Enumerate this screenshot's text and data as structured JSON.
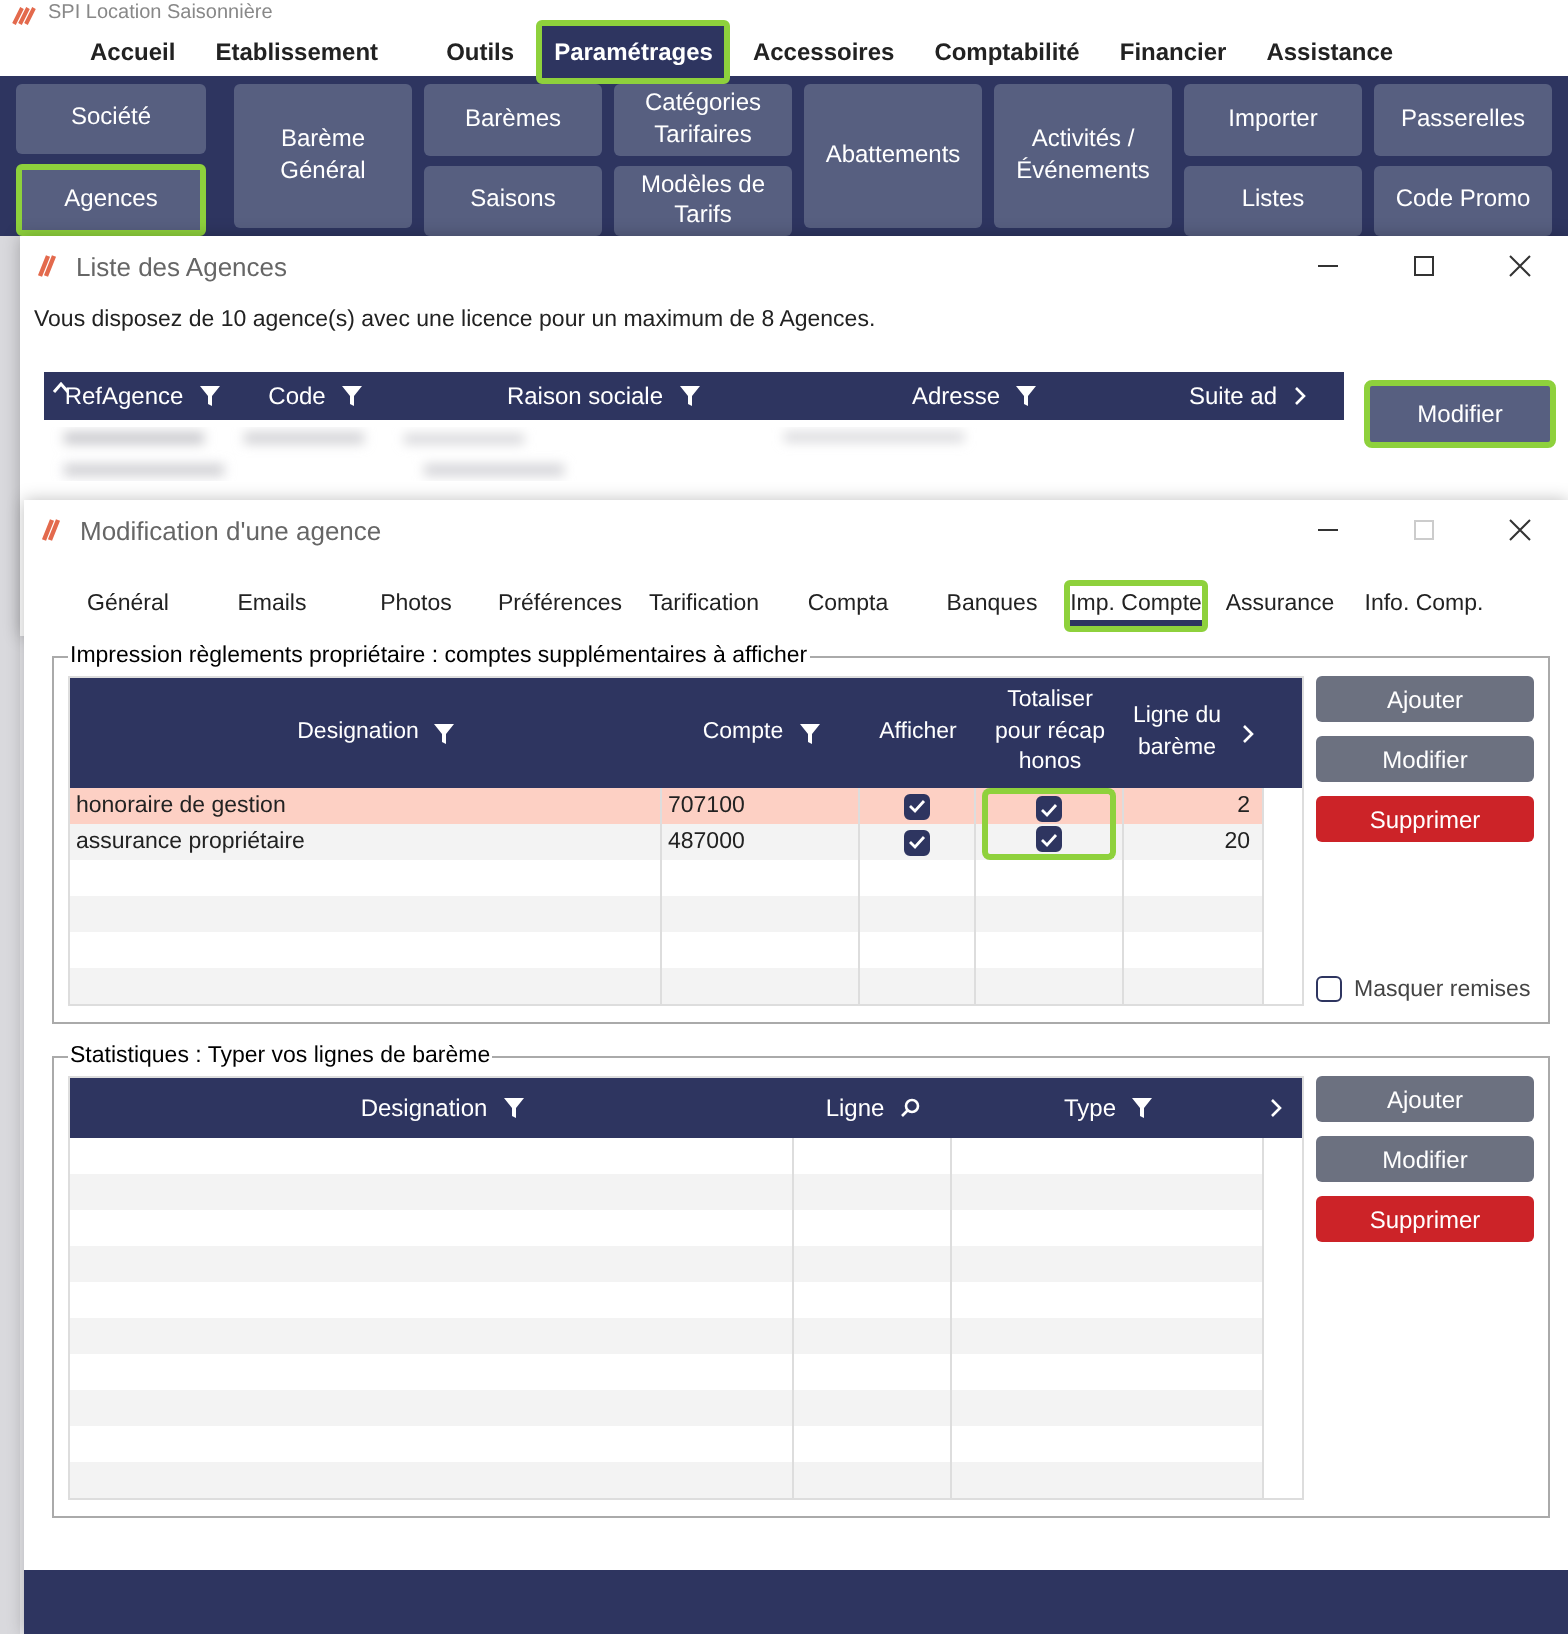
{
  "app": {
    "title": "SPI Location Saisonnière"
  },
  "menu": [
    {
      "label": "Accueil",
      "selected": false,
      "highlighted": false
    },
    {
      "label": "Etablissement",
      "selected": false,
      "highlighted": false
    },
    {
      "label": "Outils",
      "selected": false,
      "highlighted": false
    },
    {
      "label": "Paramétrages",
      "selected": true,
      "highlighted": true
    },
    {
      "label": "Accessoires",
      "selected": false,
      "highlighted": false
    },
    {
      "label": "Comptabilité",
      "selected": false,
      "highlighted": false
    },
    {
      "label": "Financier",
      "selected": false,
      "highlighted": false
    },
    {
      "label": "Assistance",
      "selected": false,
      "highlighted": false
    }
  ],
  "ribbon": [
    {
      "buttons": [
        {
          "label": "Société",
          "highlighted": false
        },
        {
          "label": "Agences",
          "highlighted": true
        }
      ]
    },
    {
      "buttons": [
        {
          "label": "Barème Général",
          "highlighted": false
        }
      ]
    },
    {
      "buttons": [
        {
          "label": "Barèmes",
          "highlighted": false
        },
        {
          "label": "Saisons",
          "highlighted": false
        }
      ]
    },
    {
      "buttons": [
        {
          "label": "Catégories Tarifaires",
          "highlighted": false
        },
        {
          "label": "Modèles de Tarifs",
          "highlighted": false
        }
      ]
    },
    {
      "buttons": [
        {
          "label": "Abattements",
          "highlighted": false
        }
      ]
    },
    {
      "buttons": [
        {
          "label": "Activités / Événements",
          "highlighted": false
        }
      ]
    },
    {
      "buttons": [
        {
          "label": "Importer",
          "highlighted": false
        },
        {
          "label": "Listes",
          "highlighted": false
        }
      ]
    },
    {
      "buttons": [
        {
          "label": "Passerelles",
          "highlighted": false
        },
        {
          "label": "Code Promo",
          "highlighted": false
        }
      ]
    }
  ],
  "agency_list_window": {
    "title": "Liste des Agences",
    "message": "Vous disposez de 10 agence(s) avec une licence pour un maximum de 8 Agences.",
    "columns": [
      {
        "label": "RefAgence"
      },
      {
        "label": "Code"
      },
      {
        "label": "Raison sociale"
      },
      {
        "label": "Adresse"
      },
      {
        "label": "Suite ad"
      }
    ],
    "actions": [
      {
        "label": "Modifier",
        "highlighted": true
      }
    ]
  },
  "edit_window": {
    "title": "Modification d'une agence",
    "tabs": [
      {
        "label": "Général",
        "selected": false,
        "highlighted": false
      },
      {
        "label": "Emails",
        "selected": false,
        "highlighted": false
      },
      {
        "label": "Photos",
        "selected": false,
        "highlighted": false
      },
      {
        "label": "Préférences",
        "selected": false,
        "highlighted": false
      },
      {
        "label": "Tarification",
        "selected": false,
        "highlighted": false
      },
      {
        "label": "Compta",
        "selected": false,
        "highlighted": false
      },
      {
        "label": "Banques",
        "selected": false,
        "highlighted": false
      },
      {
        "label": "Imp. Compte",
        "selected": true,
        "highlighted": true
      },
      {
        "label": "Assurance",
        "selected": false,
        "highlighted": false
      },
      {
        "label": "Info. Comp.",
        "selected": false,
        "highlighted": false
      }
    ],
    "accounts_section": {
      "legend": "Impression règlements propriétaire : comptes supplémentaires à afficher",
      "columns": [
        {
          "label": "Designation"
        },
        {
          "label": "Compte"
        },
        {
          "label": "Afficher"
        },
        {
          "label": "Totaliser pour récap honos"
        },
        {
          "label": "Ligne du barème"
        }
      ],
      "rows": [
        {
          "designation": "honoraire de gestion",
          "compte": "707100",
          "afficher": true,
          "totaliser": true,
          "totaliser_highlighted": true,
          "ligne": "2",
          "selected": true
        },
        {
          "designation": "assurance propriétaire",
          "compte": "487000",
          "afficher": true,
          "totaliser": true,
          "totaliser_highlighted": true,
          "ligne": "20",
          "selected": false
        }
      ],
      "buttons": [
        {
          "label": "Ajouter",
          "kind": "normal"
        },
        {
          "label": "Modifier",
          "kind": "normal"
        },
        {
          "label": "Supprimer",
          "kind": "danger"
        }
      ],
      "hide_discounts": {
        "label": "Masquer remises",
        "checked": false
      }
    },
    "stats_section": {
      "legend": "Statistiques : Typer vos lignes de barème",
      "columns": [
        {
          "label": "Designation"
        },
        {
          "label": "Ligne"
        },
        {
          "label": "Type"
        }
      ],
      "buttons": [
        {
          "label": "Ajouter",
          "kind": "normal"
        },
        {
          "label": "Modifier",
          "kind": "normal"
        },
        {
          "label": "Supprimer",
          "kind": "danger"
        }
      ]
    }
  }
}
